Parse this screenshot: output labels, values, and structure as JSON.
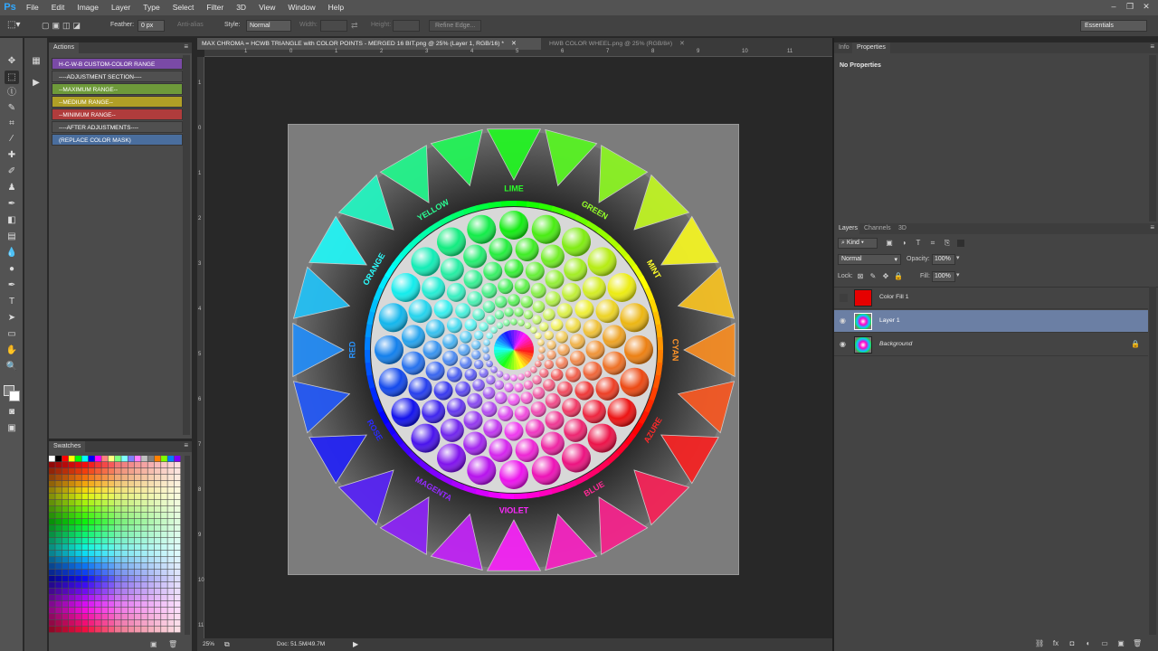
{
  "menubar": {
    "logo": "Ps",
    "items": [
      "File",
      "Edit",
      "Image",
      "Layer",
      "Type",
      "Select",
      "Filter",
      "3D",
      "View",
      "Window",
      "Help"
    ]
  },
  "options": {
    "feather_label": "Feather:",
    "feather_value": "0 px",
    "antialias_label": "Anti-alias",
    "style_label": "Style:",
    "style_value": "Normal",
    "width_label": "Width:",
    "height_label": "Height:",
    "refine_edge": "Refine Edge...",
    "workspace": "Essentials"
  },
  "actions": {
    "tab": "Actions",
    "rows": [
      {
        "label": "H-C-W-B CUSTOM-COLOR RANGE",
        "color": "#7a4aa6"
      },
      {
        "label": "----ADJUSTMENT SECTION----",
        "color": "#505050"
      },
      {
        "label": "--MAXIMUM RANGE--",
        "color": "#6e9a3a"
      },
      {
        "label": "--MEDIUM RANGE--",
        "color": "#b0a026"
      },
      {
        "label": "--MINIMUM RANGE--",
        "color": "#b03c3c"
      },
      {
        "label": "----AFTER ADJUSTMENTS----",
        "color": "#505050"
      },
      {
        "label": "(REPLACE COLOR MASK)",
        "color": "#4a6e9e"
      }
    ]
  },
  "swatches": {
    "tab": "Swatches"
  },
  "document": {
    "tabs": [
      {
        "label": "MAX CHROMA = HCWB TRIANGLE with COLOR POINTS - MERGED 16 BIT.png @ 25% (Layer 1, RGB/16) *",
        "active": true
      },
      {
        "label": "HWB COLOR WHEEL.png @ 25% (RGB/8#)",
        "active": false
      }
    ],
    "ruler_top": [
      "1",
      "0",
      "1",
      "2",
      "3",
      "4",
      "5",
      "6",
      "7",
      "8",
      "9",
      "10",
      "11"
    ],
    "ruler_left": [
      "1",
      "0",
      "1",
      "2",
      "3",
      "4",
      "5",
      "6",
      "7",
      "8",
      "9",
      "10",
      "11"
    ],
    "zoom": "25%",
    "doc_size": "Doc: 51.5M/49.7M"
  },
  "wheel_labels": [
    "LIME",
    "GREEN",
    "MINT",
    "CYAN",
    "AZURE",
    "BLUE",
    "VIOLET",
    "MAGENTA",
    "ROSE",
    "RED",
    "ORANGE",
    "YELLOW"
  ],
  "info": {
    "tabs": [
      "Info",
      "Properties"
    ],
    "no_properties": "No Properties"
  },
  "layers": {
    "tabs": [
      "Layers",
      "Channels",
      "3D"
    ],
    "kind": "Kind",
    "blend_mode": "Normal",
    "opacity_label": "Opacity:",
    "opacity_value": "100%",
    "lock_label": "Lock:",
    "fill_label": "Fill:",
    "fill_value": "100%",
    "items": [
      {
        "name": "Color Fill 1",
        "visible": false,
        "selected": false
      },
      {
        "name": "Layer 1",
        "visible": true,
        "selected": true
      },
      {
        "name": "Background",
        "visible": true,
        "selected": false,
        "locked": true
      }
    ]
  },
  "colors": {
    "ui_dark": "#282828",
    "panel": "#444444",
    "selection": "#6b7fa4",
    "fill_layer": "#e60000"
  }
}
